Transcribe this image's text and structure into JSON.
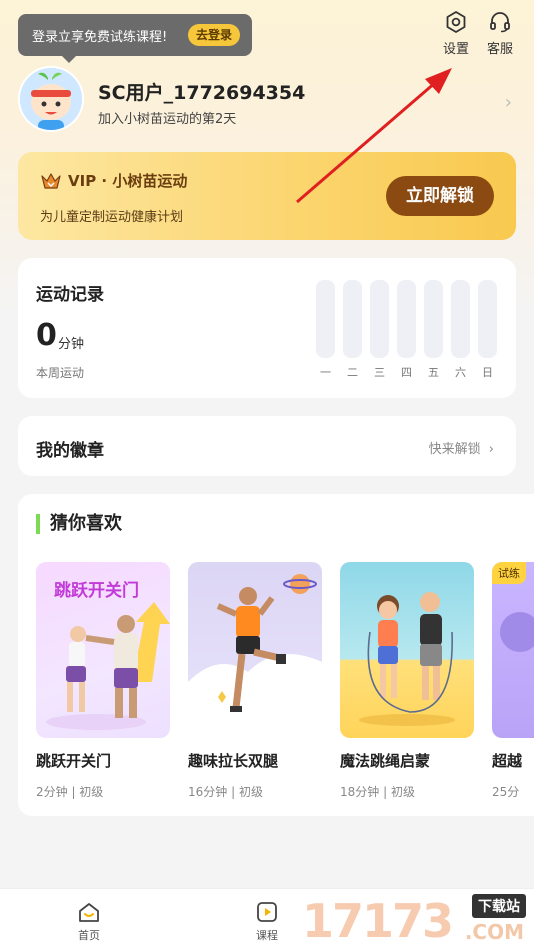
{
  "login_tip": {
    "text": "登录立享免费试练课程!",
    "button": "去登录"
  },
  "top_actions": {
    "settings": "设置",
    "service": "客服"
  },
  "user": {
    "name": "SC用户_1772694354",
    "days_text": "加入小树苗运动的第2天"
  },
  "vip": {
    "title": "VIP · 小树苗运动",
    "desc": "为儿童定制运动健康计划",
    "button": "立即解锁"
  },
  "record": {
    "title": "运动记录",
    "minutes": "0",
    "unit": "分钟",
    "sub": "本周运动",
    "days": [
      "一",
      "二",
      "三",
      "四",
      "五",
      "六",
      "日"
    ]
  },
  "badges": {
    "title": "我的徽章",
    "more": "快来解锁"
  },
  "guess": {
    "title": "猜你喜欢",
    "courses": [
      {
        "name": "跳跃开关门",
        "meta": "2分钟 | 初级",
        "thumb_text": "跳跃开关门"
      },
      {
        "name": "趣味拉长双腿",
        "meta": "16分钟 | 初级"
      },
      {
        "name": "魔法跳绳启蒙",
        "meta": "18分钟 | 初级"
      },
      {
        "name": "超越",
        "meta": "25分",
        "tag": "试练"
      }
    ]
  },
  "tabbar": {
    "home": "首页",
    "course": "课程"
  },
  "watermark": {
    "number": "17173",
    "site": "下载站",
    "domain": ".COM"
  }
}
